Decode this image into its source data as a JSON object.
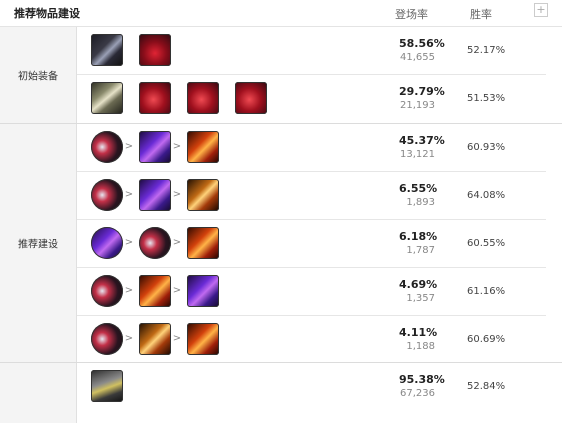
{
  "header": {
    "title": "推荐物品建设",
    "pick_rate": "登场率",
    "win_rate": "胜率",
    "plus": "+"
  },
  "sections": [
    {
      "label": "初始装备"
    },
    {
      "label": "推荐建设"
    }
  ],
  "rows": [
    {
      "pick": "58.56%",
      "count": "41,655",
      "win": "52.17%"
    },
    {
      "pick": "29.79%",
      "count": "21,193",
      "win": "51.53%"
    },
    {
      "pick": "45.37%",
      "count": "13,121",
      "win": "60.93%"
    },
    {
      "pick": "6.55%",
      "count": "1,893",
      "win": "64.08%"
    },
    {
      "pick": "6.18%",
      "count": "1,787",
      "win": "60.55%"
    },
    {
      "pick": "4.69%",
      "count": "1,357",
      "win": "61.16%"
    },
    {
      "pick": "4.11%",
      "count": "1,188",
      "win": "60.69%"
    },
    {
      "pick": "95.38%",
      "count": "67,236",
      "win": "52.84%"
    }
  ],
  "arrow": ">",
  "icons": {
    "r0": [
      "long-sword-icon",
      "health-potion-icon"
    ],
    "r1": [
      "doran-blade-icon",
      "health-potion-icon",
      "health-potion-icon",
      "health-potion-icon"
    ],
    "r2": [
      "blade-icon",
      "purple-item-icon",
      "fire-item-icon"
    ],
    "r3": [
      "blade-icon",
      "purple-item-icon",
      "golden-spear-icon"
    ],
    "r4": [
      "purple-item-icon",
      "blade-icon",
      "fire-item-icon"
    ],
    "r5": [
      "blade-icon",
      "fire-item-icon",
      "purple-item-icon"
    ],
    "r6": [
      "blade-icon",
      "golden-spear-icon",
      "fire-item-icon"
    ],
    "r7": [
      "boots-icon"
    ]
  }
}
